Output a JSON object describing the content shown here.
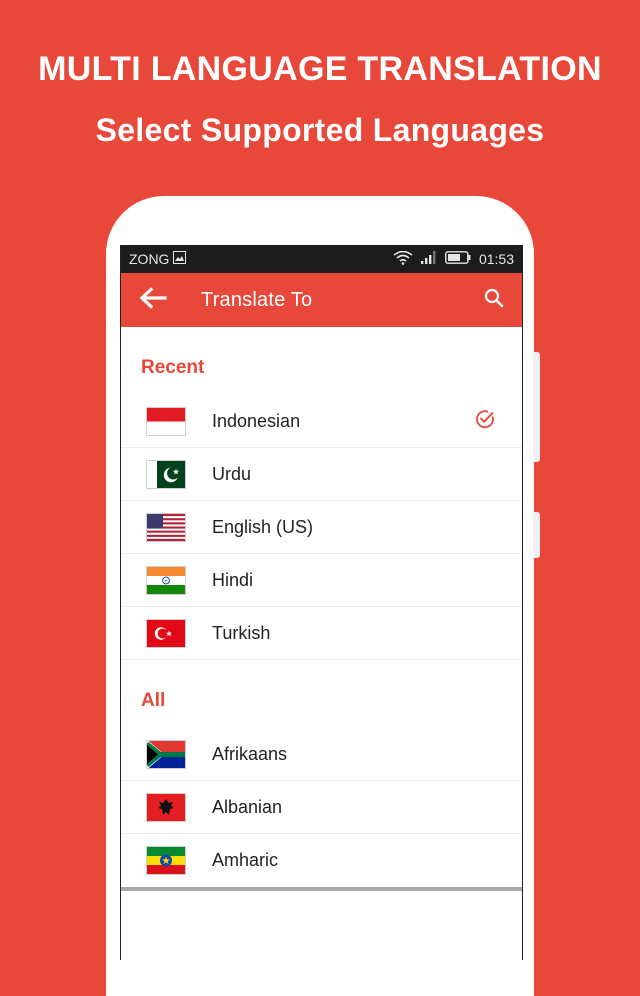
{
  "promo": {
    "headline": "MULTI LANGUAGE TRANSLATION",
    "subheadline": "Select Supported Languages"
  },
  "colors": {
    "accent": "#e8483a",
    "statusbar": "#1c1c1c"
  },
  "statusbar": {
    "carrier": "ZONG",
    "time": "01:53"
  },
  "appbar": {
    "title": "Translate To",
    "back_icon": "arrow-left-icon",
    "search_icon": "search-icon"
  },
  "sections": {
    "recent": {
      "label": "Recent",
      "items": [
        {
          "name": "Indonesian",
          "flag": "flag-indonesia-icon",
          "selected": true
        },
        {
          "name": "Urdu",
          "flag": "flag-pakistan-icon"
        },
        {
          "name": "English (US)",
          "flag": "flag-usa-icon"
        },
        {
          "name": "Hindi",
          "flag": "flag-india-icon"
        },
        {
          "name": "Turkish",
          "flag": "flag-turkey-icon"
        }
      ]
    },
    "all": {
      "label": "All",
      "items": [
        {
          "name": "Afrikaans",
          "flag": "flag-south-africa-icon"
        },
        {
          "name": "Albanian",
          "flag": "flag-albania-icon"
        },
        {
          "name": "Amharic",
          "flag": "flag-ethiopia-icon"
        }
      ]
    }
  }
}
